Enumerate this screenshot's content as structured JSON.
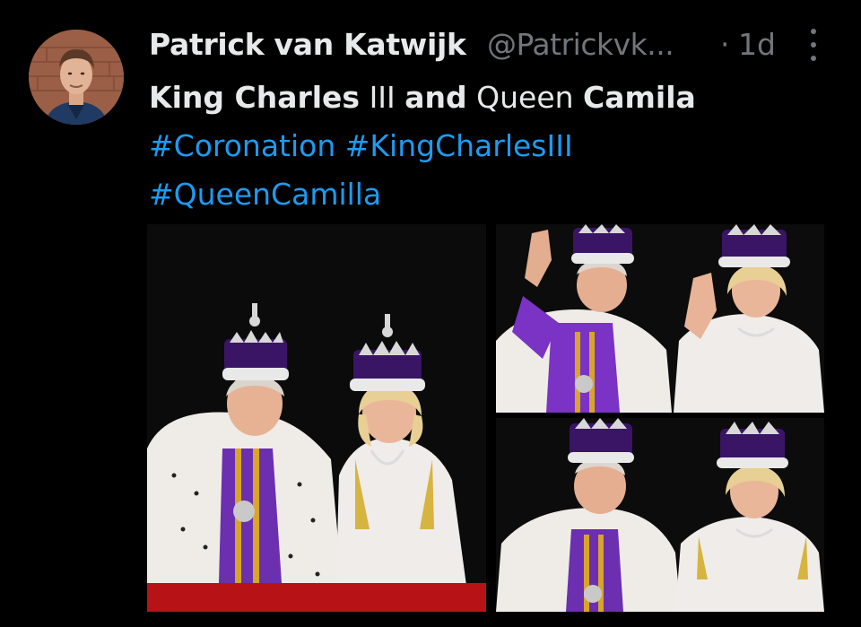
{
  "tweet": {
    "author_name": "Patrick van Katwijk",
    "author_handle": "@Patrickvk...",
    "separator": "·",
    "timestamp": "1d",
    "text_line1": {
      "part1": "King Charles",
      "part2": " III ",
      "part3": "and",
      "part4": " Queen ",
      "part5": "Camila"
    },
    "hashtags": [
      "#Coronation",
      "#KingCharlesIII",
      "#QueenCamilla"
    ]
  },
  "colors": {
    "background": "#000000",
    "primary_text": "#e7e9ea",
    "secondary_text": "#71767b",
    "link": "#1d9bf0"
  },
  "icons": {
    "more": "more-vertical-icon"
  }
}
